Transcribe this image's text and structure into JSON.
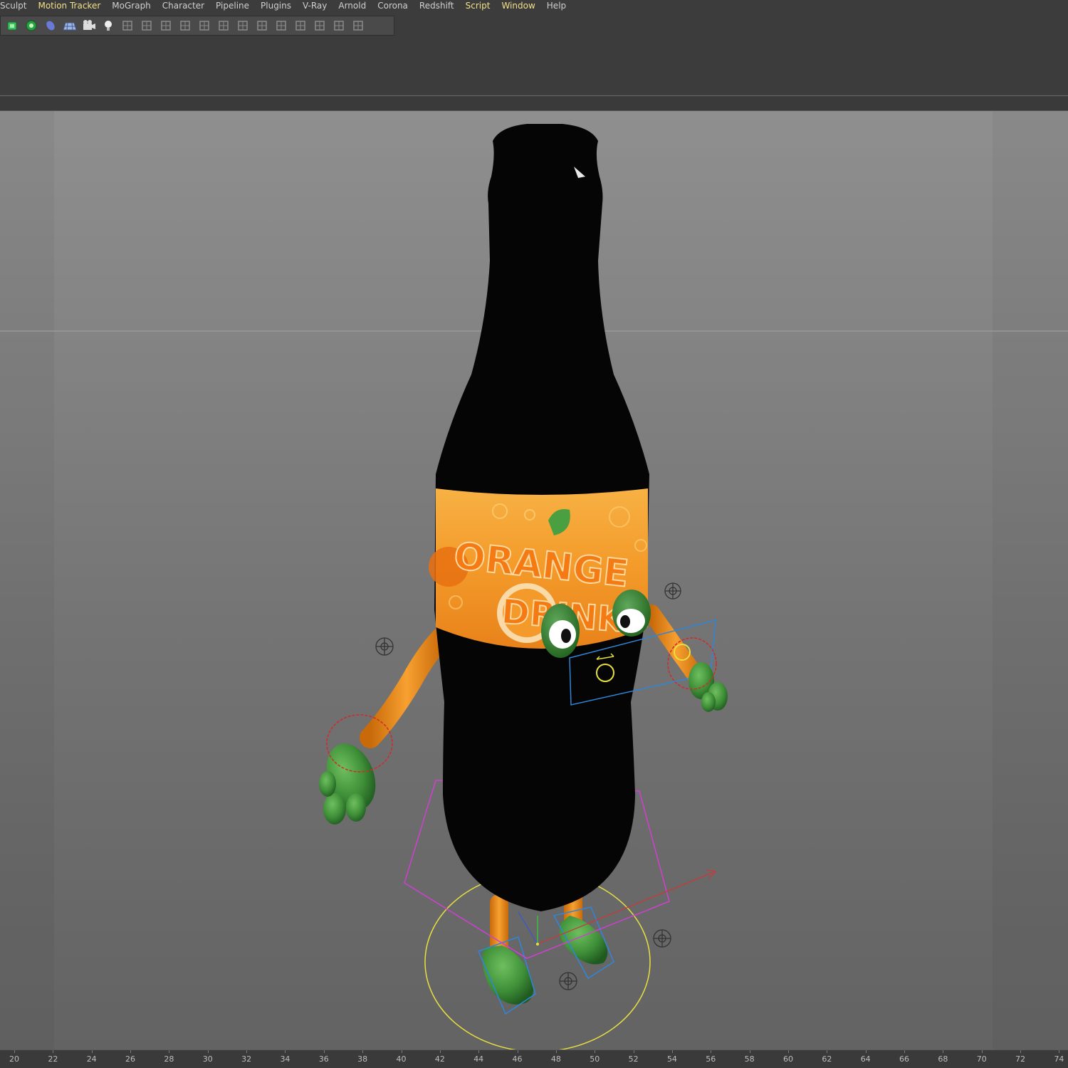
{
  "menu": [
    "Sculpt",
    "Motion Tracker",
    "MoGraph",
    "Character",
    "Pipeline",
    "Plugins",
    "V-Ray",
    "Arnold",
    "Corona",
    "Redshift",
    "Script",
    "Window",
    "Help"
  ],
  "menu_highlighted": [
    "Motion Tracker",
    "Script",
    "Window"
  ],
  "toolbar_icons": [
    "cube-object-icon",
    "spline-gear-icon",
    "nurbs-icon",
    "floor-grid-icon",
    "camera-icon",
    "light-bulb-icon",
    "deformer-icon",
    "symmetry-icon",
    "polygon-cube-icon",
    "joint-tool-icon",
    "ik-tool-icon",
    "bone-tool-icon",
    "mesh-tool-icon",
    "box-tool-icon",
    "array-icon",
    "grid-array-icon",
    "dots-grid-icon",
    "dots-grid-icon-2",
    "dots-grid-icon-3"
  ],
  "label_text": [
    "ORANGE",
    "DRINK"
  ],
  "ruler": {
    "labels": [
      "20",
      "22",
      "24",
      "26",
      "28",
      "30",
      "32",
      "34",
      "36",
      "38",
      "40",
      "42",
      "44",
      "46",
      "48",
      "50",
      "52",
      "54",
      "56",
      "58",
      "60",
      "62",
      "64",
      "66",
      "68",
      "70",
      "72",
      "74"
    ]
  },
  "colors": {
    "menu_text": "#cfcfcf",
    "menu_highlight": "#f2e08a",
    "bottle": "#050505",
    "label_orange": "#f39a2a",
    "limb_orange": "#f0901e",
    "glove_green": "#3f8f38",
    "control_red": "#d22a2a",
    "control_yellow": "#e8e040",
    "control_blue": "#2f86d8",
    "control_magenta": "#d040d0"
  }
}
